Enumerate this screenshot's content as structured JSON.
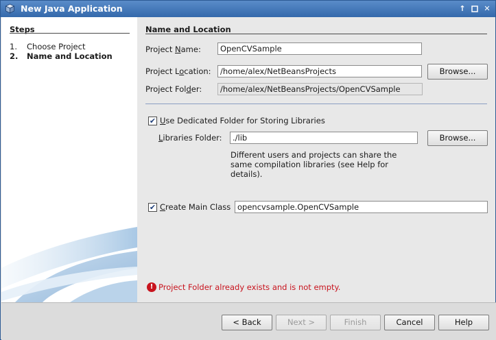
{
  "window": {
    "title": "New Java Application"
  },
  "steps": {
    "heading": "Steps",
    "items": [
      {
        "num": "1.",
        "label": "Choose Project"
      },
      {
        "num": "2.",
        "label": "Name and Location"
      }
    ]
  },
  "form": {
    "section_title": "Name and Location",
    "project_name": {
      "label_pre": "Project ",
      "label_mn": "N",
      "label_post": "ame:",
      "value": "OpenCVSample"
    },
    "project_location": {
      "label_pre": "Project L",
      "label_mn": "o",
      "label_post": "cation:",
      "value": "/home/alex/NetBeansProjects",
      "browse": "Browse..."
    },
    "project_folder": {
      "label_pre": "Project Fol",
      "label_mn": "d",
      "label_post": "er:",
      "value": "/home/alex/NetBeansProjects/OpenCVSample"
    },
    "dedicated_folder": {
      "checked": true,
      "label_mn": "U",
      "label_post": "se Dedicated Folder for Storing Libraries"
    },
    "libraries_folder": {
      "label_mn": "L",
      "label_post": "ibraries Folder:",
      "value": "./lib",
      "browse": "Browse..."
    },
    "libraries_help": "Different users and projects can share the same compilation libraries (see Help for details).",
    "main_class": {
      "checked": true,
      "label_mn": "C",
      "label_post": "reate Main Class",
      "value": "opencvsample.OpenCVSample"
    },
    "error_message": "Project Folder already exists and is not empty."
  },
  "buttons": {
    "back": "< Back",
    "next": "Next >",
    "finish": "Finish",
    "cancel": "Cancel",
    "help": "Help"
  },
  "colors": {
    "titlebar": "#3469ab",
    "error": "#c8141e"
  }
}
